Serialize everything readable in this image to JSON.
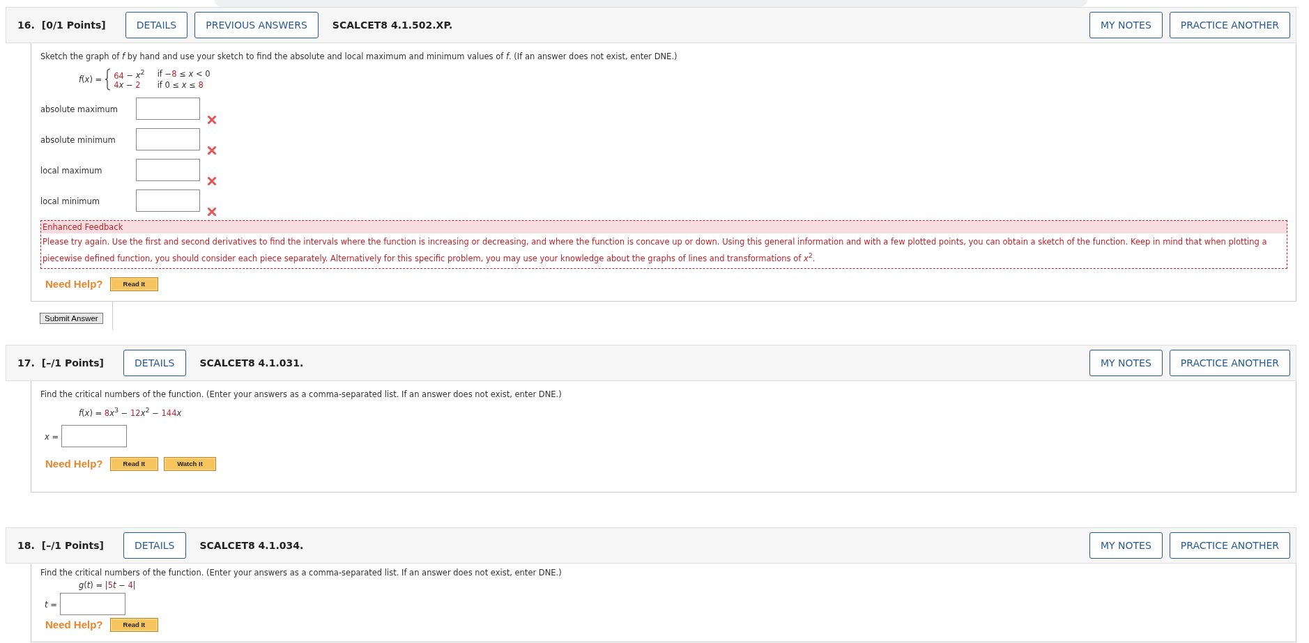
{
  "questions": [
    {
      "number": "16.",
      "points": "[0/1 Points]",
      "header_buttons": [
        "DETAILS",
        "PREVIOUS ANSWERS"
      ],
      "code": "SCALCET8 4.1.502.XP.",
      "right_buttons": [
        "MY NOTES",
        "PRACTICE ANOTHER"
      ],
      "prompt": "Sketch the graph of *f* by hand and use your sketch to find the absolute and local maximum and minimum values of *f*. (If an answer does not exist, enter DNE.)",
      "formula": {
        "kind": "piecewise",
        "lhs": "*f*(*x*) =",
        "rows": [
          {
            "expr": [
              {
                "t": "64",
                "red": true
              },
              {
                "t": " − *x*$^{2}$",
                "red": false
              }
            ],
            "cond": [
              {
                "t": "if −",
                "red": false
              },
              {
                "t": "8",
                "red": true
              },
              {
                "t": " ≤ *x* < 0",
                "red": false
              }
            ]
          },
          {
            "expr": [
              {
                "t": "4",
                "red": true
              },
              {
                "t": "*x* − ",
                "red": false
              },
              {
                "t": "2",
                "red": true
              }
            ],
            "cond": [
              {
                "t": "if 0 ≤ *x* ≤ ",
                "red": false
              },
              {
                "t": "8",
                "red": true
              }
            ]
          }
        ]
      },
      "answers": [
        {
          "label": "absolute maximum",
          "incorrect": true
        },
        {
          "label": "absolute minimum",
          "incorrect": true
        },
        {
          "label": "local maximum",
          "incorrect": true
        },
        {
          "label": "local minimum",
          "incorrect": true
        }
      ],
      "feedback": {
        "title": "Enhanced Feedback",
        "text": "Please try again. Use the first and second derivatives to find the intervals where the function is increasing or decreasing, and where the function is concave up or down. Using this general information and with a few plotted points, you can obtain a sketch of the function. Keep in mind that when plotting a piecewise defined function, you should consider each piece separately. Alternatively for this specific problem, you may use your knowledge about the graphs of lines and transformations of  *x*$^{2}$."
      },
      "need_help": {
        "label": "Need Help?",
        "buttons": [
          "Read It"
        ]
      },
      "submit": "Submit Answer"
    },
    {
      "number": "17.",
      "points": "[–/1 Points]",
      "header_buttons": [
        "DETAILS"
      ],
      "code": "SCALCET8 4.1.031.",
      "right_buttons": [
        "MY NOTES",
        "PRACTICE ANOTHER"
      ],
      "prompt": "Find the critical numbers of the function. (Enter your answers as a comma-separated list. If an answer does not exist, enter DNE.)",
      "formula": {
        "kind": "inline",
        "parts": [
          {
            "t": "*f*(*x*) = ",
            "red": false
          },
          {
            "t": "8",
            "red": true
          },
          {
            "t": "*x*$^{3}$ − ",
            "red": false
          },
          {
            "t": "12",
            "red": true
          },
          {
            "t": "*x*$^{2}$ − ",
            "red": false
          },
          {
            "t": "144",
            "red": true
          },
          {
            "t": "*x*",
            "red": false
          }
        ]
      },
      "answers": [
        {
          "label": "*x* =",
          "incorrect": false,
          "kind": "inline"
        }
      ],
      "need_help": {
        "label": "Need Help?",
        "buttons": [
          "Read It",
          "Watch It"
        ]
      }
    },
    {
      "number": "18.",
      "points": "[–/1 Points]",
      "header_buttons": [
        "DETAILS"
      ],
      "code": "SCALCET8 4.1.034.",
      "right_buttons": [
        "MY NOTES",
        "PRACTICE ANOTHER"
      ],
      "prompt": "Find the critical numbers of the function. (Enter your answers as a comma-separated list. If an answer does not exist, enter DNE.)",
      "formula": {
        "kind": "inline",
        "parts": [
          {
            "t": "*g*(*t*) = |",
            "red": false
          },
          {
            "t": "5",
            "red": true
          },
          {
            "t": "*t* − ",
            "red": false
          },
          {
            "t": "4",
            "red": true
          },
          {
            "t": "|",
            "red": false
          }
        ]
      },
      "answers": [
        {
          "label": "*t* =",
          "incorrect": false,
          "kind": "inline"
        }
      ],
      "need_help": {
        "label": "Need Help?",
        "buttons": [
          "Read It"
        ]
      }
    }
  ]
}
